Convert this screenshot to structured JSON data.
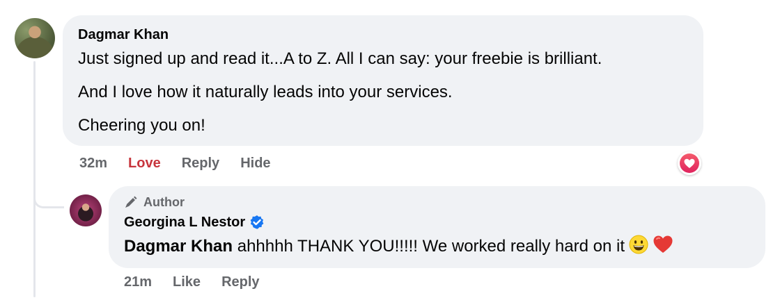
{
  "comment": {
    "author_name": "Dagmar Khan",
    "paragraphs": [
      "Just signed up and read it...A to Z. All I can say: your freebie is brilliant.",
      "And I love how it naturally leads into your services.",
      "Cheering you on!"
    ],
    "time": "32m",
    "reaction_label": "Love",
    "reply_label": "Reply",
    "hide_label": "Hide",
    "reaction_icon": "heart-reaction-icon",
    "colors": {
      "love": "#c7353d",
      "bubble": "#f0f2f5",
      "meta": "#65676b"
    }
  },
  "reply": {
    "badge_label": "Author",
    "badge_icon": "pen-icon",
    "author_name": "Georgina L Nestor",
    "verified_icon": "verified-badge-icon",
    "mention": "Dagmar Khan",
    "text": " ahhhhh THANK YOU!!!!! We worked really hard on it",
    "emojis": [
      "grinning-face-emoji",
      "red-heart-emoji"
    ],
    "time": "21m",
    "like_label": "Like",
    "reply_label": "Reply",
    "colors": {
      "verified": "#1877f2"
    }
  }
}
